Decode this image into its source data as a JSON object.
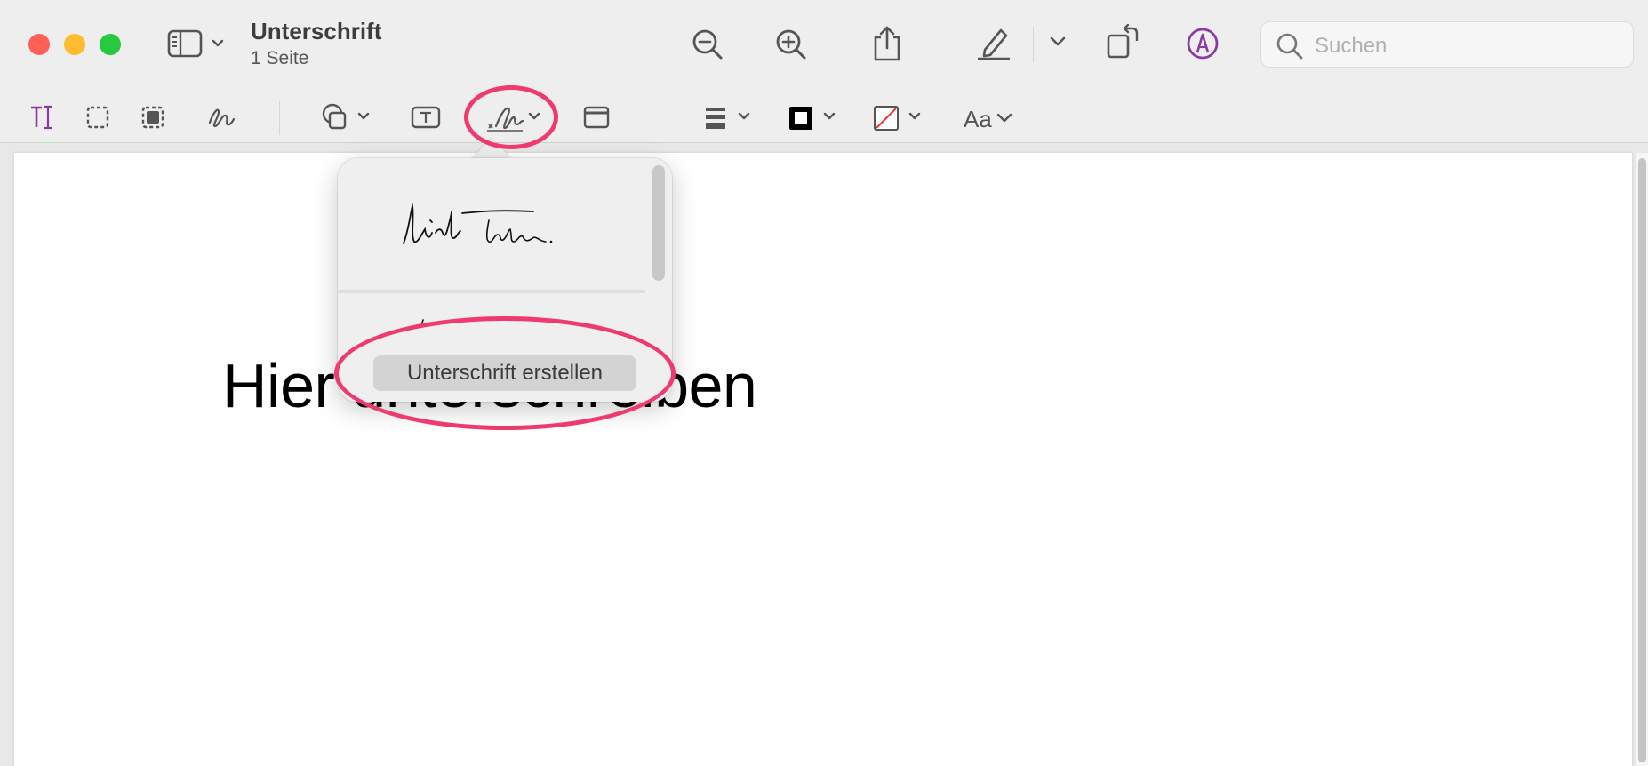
{
  "window": {
    "title": "Unterschrift",
    "subtitle": "1 Seite"
  },
  "traffic_lights": {
    "close_color": "#fe5f57",
    "minimize_color": "#febc2e",
    "zoom_color": "#28c840"
  },
  "toolbar": {
    "icons": [
      "sidebar-icon",
      "zoom-out-icon",
      "zoom-in-icon",
      "share-icon",
      "highlight-pen-icon",
      "rotate-icon",
      "markup-icon"
    ],
    "accent_color": "#8a3aa0"
  },
  "search": {
    "placeholder": "Suchen"
  },
  "markup_toolbar": {
    "icons": [
      "text-selection-icon",
      "rect-selection-icon",
      "smart-lasso-icon",
      "sketch-icon",
      "shapes-icon",
      "text-box-icon",
      "signature-icon",
      "note-icon",
      "line-style-icon",
      "border-color-icon",
      "fill-color-icon"
    ],
    "text_style_label": "Aa"
  },
  "document": {
    "text": "Hier unterschreiben"
  },
  "signature_popover": {
    "create_button_label": "Unterschrift erstellen"
  },
  "highlight_color": "#ee3a6e"
}
